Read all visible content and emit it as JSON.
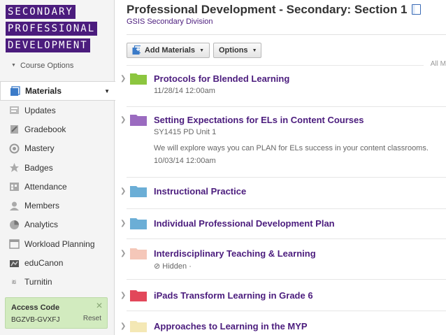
{
  "sidebar": {
    "logo_lines": [
      "SECONDARY",
      "PROFESSIONAL",
      "DEVELOPMENT"
    ],
    "course_options": "Course Options",
    "nav": [
      {
        "label": "Materials",
        "icon": "materials-icon",
        "active": true
      },
      {
        "label": "Updates",
        "icon": "updates-icon"
      },
      {
        "label": "Gradebook",
        "icon": "gradebook-icon"
      },
      {
        "label": "Mastery",
        "icon": "mastery-icon"
      },
      {
        "label": "Badges",
        "icon": "badges-icon"
      },
      {
        "label": "Attendance",
        "icon": "attendance-icon"
      },
      {
        "label": "Members",
        "icon": "members-icon"
      },
      {
        "label": "Analytics",
        "icon": "analytics-icon"
      },
      {
        "label": "Workload Planning",
        "icon": "workload-icon"
      },
      {
        "label": "eduCanon",
        "icon": "educanon-icon"
      },
      {
        "label": "Turnitin",
        "icon": "turnitin-icon"
      }
    ],
    "access_code": {
      "label": "Access Code",
      "code": "BGZVB-GVXFJ",
      "reset": "Reset"
    }
  },
  "header": {
    "title": "Professional Development - Secondary: Section 1",
    "subtitle": "GSIS Secondary Division"
  },
  "toolbar": {
    "add_materials": "Add Materials",
    "options": "Options",
    "all_materials_partial": "All M"
  },
  "folders": [
    {
      "name": "Protocols for Blended Learning",
      "color": "#8cc63f",
      "lines": [
        "11/28/14 12:00am"
      ]
    },
    {
      "name": "Setting Expectations for ELs in Content Courses",
      "color": "#9b6bc0",
      "lines": [
        "SY1415 PD Unit 1",
        "We will explore ways you can PLAN for ELs success in your content classrooms.",
        "10/03/14 12:00am"
      ]
    },
    {
      "name": "Instructional Practice",
      "color": "#6baed6",
      "lines": []
    },
    {
      "name": "Individual Professional Development Plan",
      "color": "#6baed6",
      "lines": []
    },
    {
      "name": "Interdisciplinary Teaching & Learning",
      "color": "#f4c7b8",
      "lines": [
        "⊘ Hidden ·"
      ]
    },
    {
      "name": "iPads Transform Learning in Grade 6",
      "color": "#e2485b",
      "lines": []
    },
    {
      "name": "Approaches to Learning in the MYP",
      "color": "#f3e7b5",
      "lines": []
    }
  ]
}
